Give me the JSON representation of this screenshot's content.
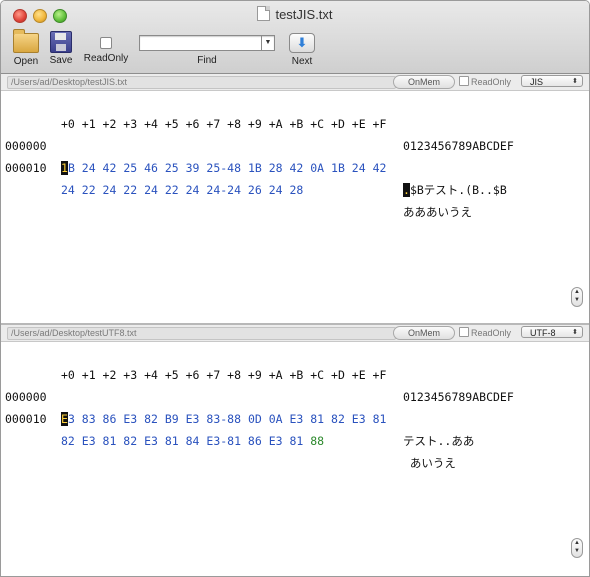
{
  "window": {
    "title": "testJIS.txt"
  },
  "toolbar": {
    "open_label": "Open",
    "save_label": "Save",
    "readonly_label": "ReadOnly",
    "find_label": "Find",
    "find_value": "",
    "next_label": "Next"
  },
  "panels": [
    {
      "path": "/Users/ad/Desktop/testJIS.txt",
      "onmem_label": "OnMem",
      "readonly_label": "ReadOnly",
      "encoding": "JIS",
      "header_hex": "+0 +1 +2 +3 +4 +5 +6 +7 +8 +9 +A +B +C +D +E +F",
      "header_ascii": "0123456789ABCDEF",
      "rows": [
        {
          "offset": "000000",
          "hex_cursor": "1",
          "hex_rest": "B 24 42 25 46 25 39 25-48 1B 28 42 0A 1B 24 42",
          "hex_tail": "",
          "ascii_cursor": ".",
          "ascii_rest": "$Bテスト.(B..$B"
        },
        {
          "offset": "000010",
          "hex_cursor": "",
          "hex_rest": "24 22 24 22 24 22 24 24-24 26 24 28",
          "hex_tail": "",
          "ascii_cursor": "",
          "ascii_rest": "あああいうえ"
        }
      ]
    },
    {
      "path": "/Users/ad/Desktop/testUTF8.txt",
      "onmem_label": "OnMem",
      "readonly_label": "ReadOnly",
      "encoding": "UTF-8",
      "header_hex": "+0 +1 +2 +3 +4 +5 +6 +7 +8 +9 +A +B +C +D +E +F",
      "header_ascii": "0123456789ABCDEF",
      "rows": [
        {
          "offset": "000000",
          "hex_cursor": "E",
          "hex_rest": "3 83 86 E3 82 B9 E3 83-88 0D 0A E3 81 82 E3 81",
          "hex_tail": "",
          "ascii_cursor": "",
          "ascii_rest": "テスト..ああ"
        },
        {
          "offset": "000010",
          "hex_cursor": "",
          "hex_rest": "82 E3 81 82 E3 81 84 E3-81 86 E3 81 ",
          "hex_tail": "88",
          "ascii_cursor": "",
          "ascii_rest": " あいうえ"
        }
      ]
    }
  ]
}
